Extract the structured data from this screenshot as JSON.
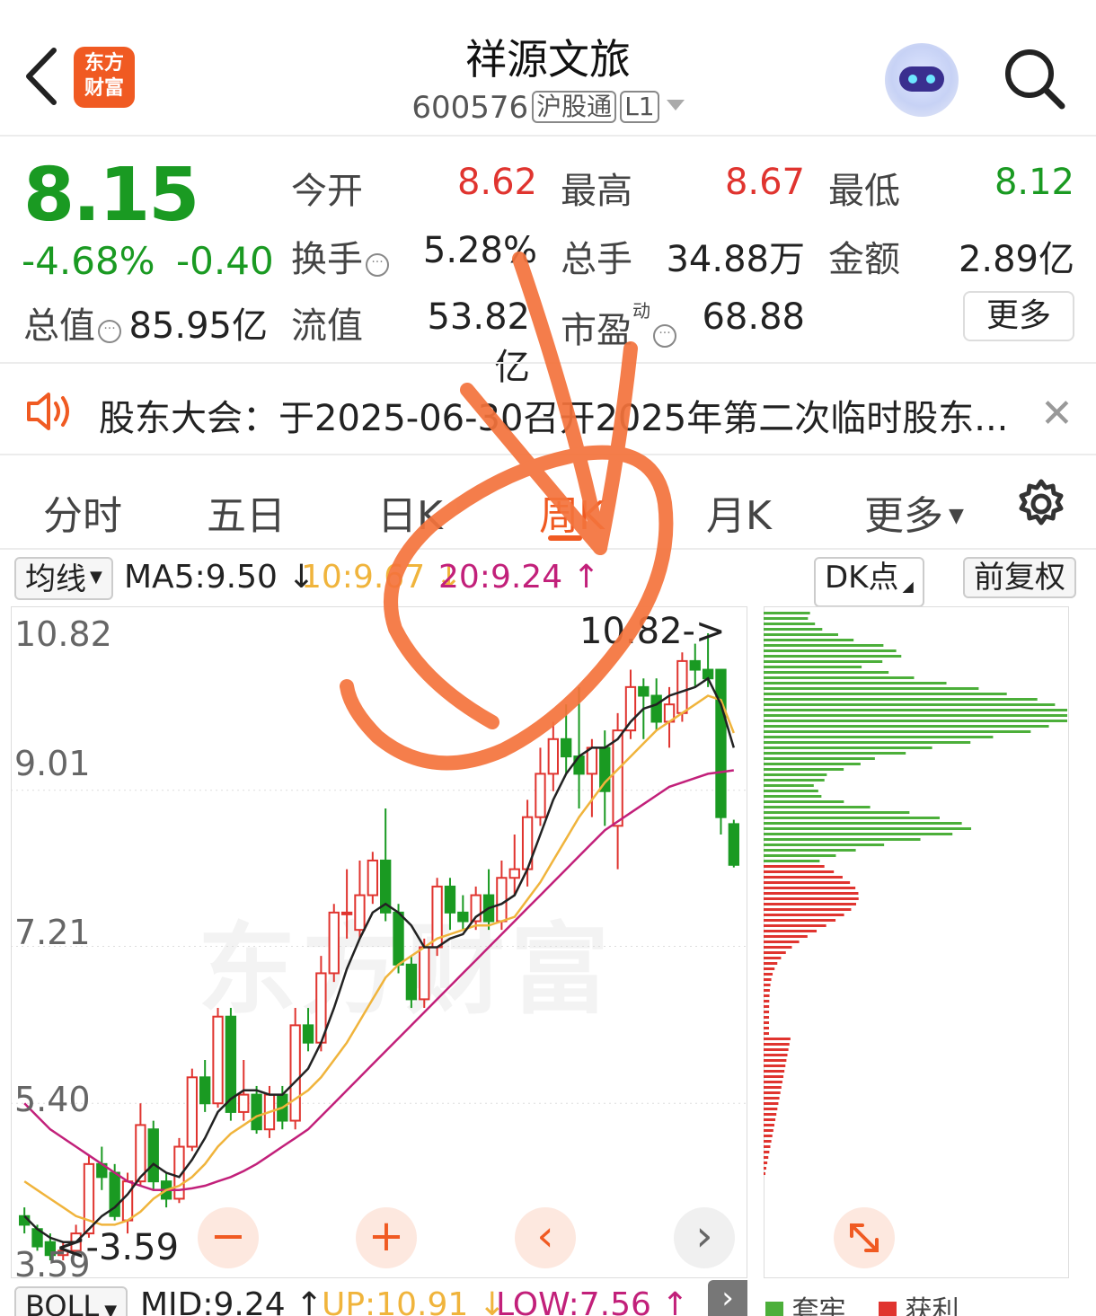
{
  "header": {
    "back_icon": "chevron-left-icon",
    "logo_text": "东方\n财富",
    "title": "祥源文旅",
    "code": "600576",
    "tag_market": "沪股通",
    "tag_level": "L1"
  },
  "quote": {
    "price": "8.15",
    "change_pct": "-4.68%",
    "change": "-0.40",
    "open_label": "今开",
    "open": "8.62",
    "high_label": "最高",
    "high": "8.67",
    "low_label": "最低",
    "low": "8.12",
    "turnover_label": "换手",
    "turnover": "5.28%",
    "volume_label": "总手",
    "volume": "34.88万",
    "amount_label": "金额",
    "amount": "2.89亿",
    "mktcap_label": "总值",
    "mktcap": "85.95亿",
    "float_label": "流值",
    "float_cap": "53.82亿",
    "pe_label": "市盈",
    "pe_sup": "动",
    "pe": "68.88",
    "more_label": "更多"
  },
  "notice": {
    "text": "股东大会：于2025-06-30召开2025年第二次临时股东..."
  },
  "tabs": [
    "分时",
    "五日",
    "日K",
    "周K",
    "月K",
    "更多"
  ],
  "active_tab": "周K",
  "indicator": {
    "type_label": "均线",
    "ma5": "MA5:9.50",
    "ma10": "10:9.67",
    "ma20": "20:9.24",
    "dk_label": "DK点",
    "adjust_label": "前复权"
  },
  "axis": {
    "y_ticks": [
      "10.82",
      "9.01",
      "7.21",
      "5.40",
      "3.59"
    ],
    "high_marker": "10.82->",
    "low_marker": "<-3.59"
  },
  "bottom": {
    "indicator": "BOLL",
    "mid": "MID:9.24",
    "up": "UP:10.91",
    "low": "LOW:7.56",
    "legend_trap": "套牢",
    "legend_profit": "获利"
  },
  "colors": {
    "up": "#e0342f",
    "down": "#1a9a22",
    "accent": "#f05a22",
    "ma5": "#222222",
    "ma10": "#f0b43c",
    "ma20": "#c2207a",
    "annotation": "#f4733c"
  },
  "chart_data": {
    "type": "candlestick",
    "ylim": [
      3.59,
      10.82
    ],
    "candles": [
      {
        "o": 4.1,
        "c": 4.0,
        "h": 4.2,
        "l": 3.9
      },
      {
        "o": 3.95,
        "c": 3.75,
        "h": 4.0,
        "l": 3.7
      },
      {
        "o": 3.8,
        "c": 3.65,
        "h": 3.9,
        "l": 3.59
      },
      {
        "o": 3.65,
        "c": 3.7,
        "h": 3.8,
        "l": 3.59
      },
      {
        "o": 3.7,
        "c": 3.9,
        "h": 4.0,
        "l": 3.65
      },
      {
        "o": 3.9,
        "c": 4.7,
        "h": 4.8,
        "l": 3.85
      },
      {
        "o": 4.7,
        "c": 4.55,
        "h": 4.9,
        "l": 4.4
      },
      {
        "o": 4.6,
        "c": 4.1,
        "h": 4.7,
        "l": 4.05
      },
      {
        "o": 4.05,
        "c": 4.5,
        "h": 4.6,
        "l": 3.9
      },
      {
        "o": 4.5,
        "c": 5.15,
        "h": 5.4,
        "l": 4.45
      },
      {
        "o": 5.1,
        "c": 4.5,
        "h": 5.2,
        "l": 4.4
      },
      {
        "o": 4.5,
        "c": 4.3,
        "h": 4.6,
        "l": 4.2
      },
      {
        "o": 4.3,
        "c": 4.9,
        "h": 5.0,
        "l": 4.25
      },
      {
        "o": 4.9,
        "c": 5.7,
        "h": 5.8,
        "l": 4.85
      },
      {
        "o": 5.7,
        "c": 5.4,
        "h": 5.9,
        "l": 5.3
      },
      {
        "o": 5.4,
        "c": 6.4,
        "h": 6.5,
        "l": 5.35
      },
      {
        "o": 6.4,
        "c": 5.3,
        "h": 6.5,
        "l": 5.2
      },
      {
        "o": 5.3,
        "c": 5.5,
        "h": 5.9,
        "l": 5.2
      },
      {
        "o": 5.5,
        "c": 5.1,
        "h": 5.6,
        "l": 5.05
      },
      {
        "o": 5.1,
        "c": 5.5,
        "h": 5.6,
        "l": 5.0
      },
      {
        "o": 5.5,
        "c": 5.2,
        "h": 5.6,
        "l": 5.1
      },
      {
        "o": 5.2,
        "c": 6.3,
        "h": 6.5,
        "l": 5.1
      },
      {
        "o": 6.3,
        "c": 6.1,
        "h": 6.5,
        "l": 6.0
      },
      {
        "o": 6.1,
        "c": 6.9,
        "h": 7.1,
        "l": 6.0
      },
      {
        "o": 6.9,
        "c": 7.6,
        "h": 7.7,
        "l": 6.8
      },
      {
        "o": 7.6,
        "c": 7.6,
        "h": 8.1,
        "l": 7.3
      },
      {
        "o": 7.4,
        "c": 7.8,
        "h": 8.2,
        "l": 7.3
      },
      {
        "o": 7.8,
        "c": 8.2,
        "h": 8.3,
        "l": 7.7
      },
      {
        "o": 8.2,
        "c": 7.6,
        "h": 8.8,
        "l": 7.5
      },
      {
        "o": 7.6,
        "c": 7.0,
        "h": 7.7,
        "l": 6.9
      },
      {
        "o": 7.0,
        "c": 6.6,
        "h": 7.1,
        "l": 6.5
      },
      {
        "o": 6.6,
        "c": 7.2,
        "h": 7.3,
        "l": 6.5
      },
      {
        "o": 7.2,
        "c": 7.9,
        "h": 8.0,
        "l": 7.1
      },
      {
        "o": 7.9,
        "c": 7.6,
        "h": 8.0,
        "l": 7.4
      },
      {
        "o": 7.6,
        "c": 7.5,
        "h": 7.8,
        "l": 7.4
      },
      {
        "o": 7.5,
        "c": 7.8,
        "h": 7.9,
        "l": 7.4
      },
      {
        "o": 7.8,
        "c": 7.5,
        "h": 8.1,
        "l": 7.4
      },
      {
        "o": 7.5,
        "c": 8.0,
        "h": 8.2,
        "l": 7.4
      },
      {
        "o": 8.0,
        "c": 8.1,
        "h": 8.5,
        "l": 7.8
      },
      {
        "o": 8.1,
        "c": 8.7,
        "h": 8.9,
        "l": 7.9
      },
      {
        "o": 8.7,
        "c": 9.2,
        "h": 9.5,
        "l": 8.6
      },
      {
        "o": 9.2,
        "c": 9.6,
        "h": 9.8,
        "l": 9.0
      },
      {
        "o": 9.6,
        "c": 9.4,
        "h": 10.0,
        "l": 9.2
      },
      {
        "o": 9.4,
        "c": 9.2,
        "h": 10.2,
        "l": 8.8
      },
      {
        "o": 9.2,
        "c": 9.5,
        "h": 9.6,
        "l": 8.7
      },
      {
        "o": 9.5,
        "c": 9.0,
        "h": 9.7,
        "l": 8.6
      },
      {
        "o": 8.6,
        "c": 9.7,
        "h": 9.9,
        "l": 8.1
      },
      {
        "o": 9.7,
        "c": 10.2,
        "h": 10.4,
        "l": 9.6
      },
      {
        "o": 10.2,
        "c": 10.1,
        "h": 10.3,
        "l": 9.6
      },
      {
        "o": 10.1,
        "c": 9.8,
        "h": 10.3,
        "l": 9.7
      },
      {
        "o": 9.8,
        "c": 10.0,
        "h": 10.2,
        "l": 9.5
      },
      {
        "o": 9.9,
        "c": 10.5,
        "h": 10.6,
        "l": 9.8
      },
      {
        "o": 10.5,
        "c": 10.4,
        "h": 10.7,
        "l": 10.2
      },
      {
        "o": 10.4,
        "c": 10.3,
        "h": 10.82,
        "l": 10.2
      },
      {
        "o": 10.4,
        "c": 8.7,
        "h": 10.4,
        "l": 8.5
      },
      {
        "o": 8.62,
        "c": 8.15,
        "h": 8.67,
        "l": 8.12
      }
    ],
    "ma5": [
      4.1,
      3.95,
      3.85,
      3.8,
      3.8,
      3.95,
      4.1,
      4.2,
      4.35,
      4.55,
      4.7,
      4.6,
      4.55,
      4.75,
      5.0,
      5.3,
      5.45,
      5.55,
      5.55,
      5.5,
      5.5,
      5.65,
      5.8,
      6.1,
      6.5,
      6.95,
      7.3,
      7.6,
      7.7,
      7.6,
      7.45,
      7.2,
      7.2,
      7.3,
      7.35,
      7.55,
      7.65,
      7.7,
      7.8,
      8.1,
      8.5,
      8.9,
      9.2,
      9.4,
      9.5,
      9.5,
      9.6,
      9.8,
      9.95,
      10.0,
      10.1,
      10.15,
      10.2,
      10.3,
      10.0,
      9.5
    ],
    "ma10": [
      4.5,
      4.4,
      4.3,
      4.2,
      4.1,
      4.05,
      4.0,
      4.0,
      4.05,
      4.15,
      4.3,
      4.4,
      4.45,
      4.55,
      4.7,
      4.9,
      5.05,
      5.15,
      5.25,
      5.3,
      5.35,
      5.45,
      5.55,
      5.7,
      5.9,
      6.1,
      6.35,
      6.6,
      6.85,
      7.0,
      7.1,
      7.2,
      7.3,
      7.35,
      7.4,
      7.45,
      7.45,
      7.5,
      7.55,
      7.75,
      7.95,
      8.2,
      8.45,
      8.7,
      8.9,
      9.1,
      9.25,
      9.4,
      9.55,
      9.7,
      9.8,
      9.9,
      10.0,
      10.1,
      10.05,
      9.67
    ],
    "ma20": [
      5.4,
      5.25,
      5.1,
      5.0,
      4.9,
      4.8,
      4.7,
      4.6,
      4.5,
      4.45,
      4.4,
      4.4,
      4.4,
      4.42,
      4.45,
      4.5,
      4.55,
      4.62,
      4.7,
      4.8,
      4.9,
      5.0,
      5.1,
      5.25,
      5.4,
      5.55,
      5.7,
      5.85,
      6.0,
      6.15,
      6.3,
      6.45,
      6.6,
      6.75,
      6.9,
      7.05,
      7.2,
      7.35,
      7.5,
      7.65,
      7.8,
      7.95,
      8.1,
      8.25,
      8.4,
      8.55,
      8.65,
      8.75,
      8.85,
      8.95,
      9.05,
      9.1,
      9.15,
      9.2,
      9.22,
      9.24
    ]
  }
}
